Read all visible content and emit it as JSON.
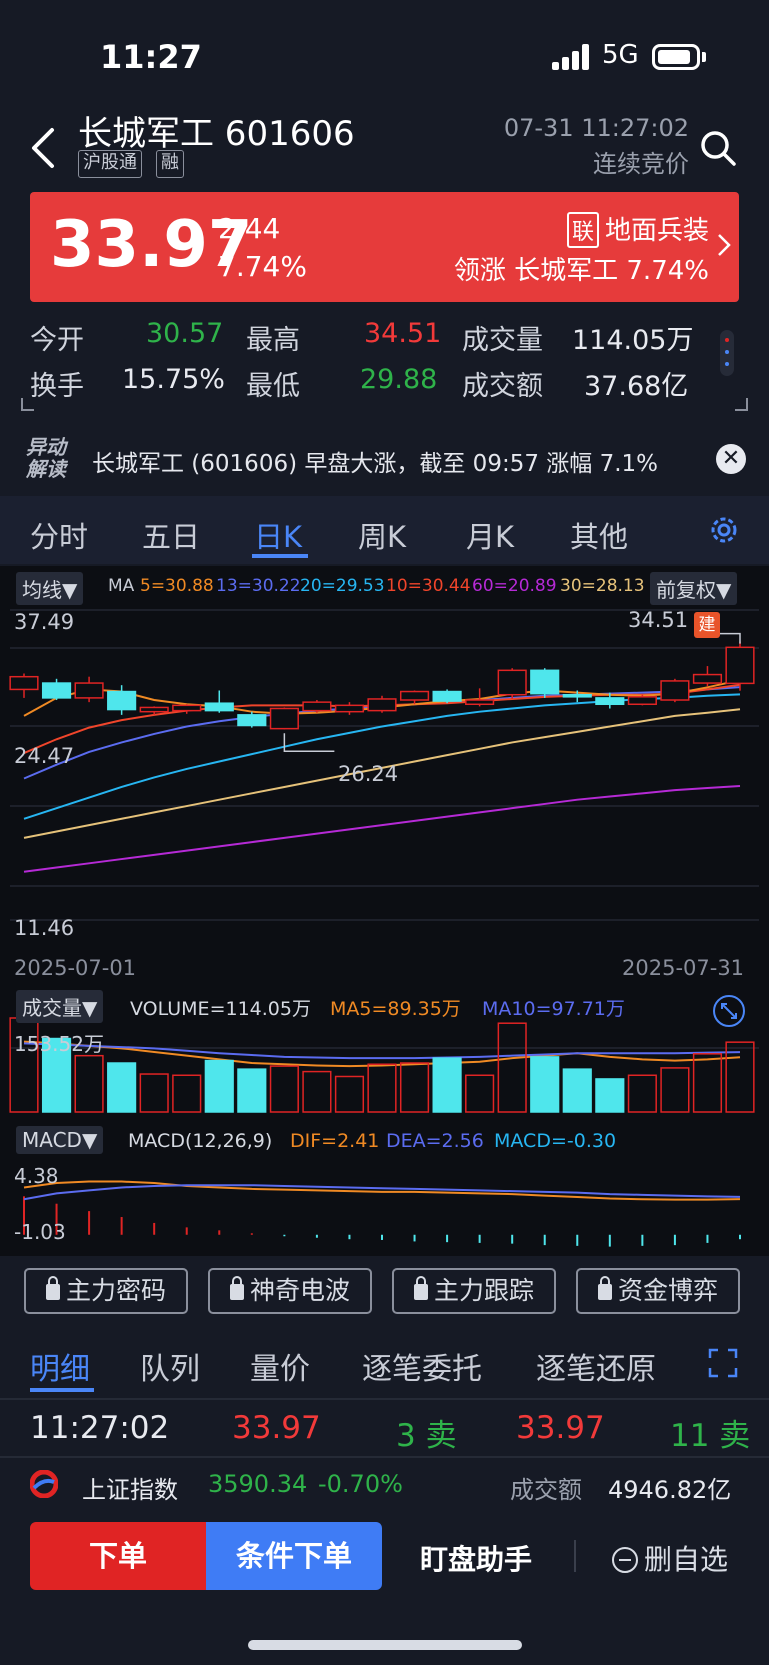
{
  "status": {
    "time": "11:27",
    "network": "5G"
  },
  "header": {
    "stock_name": "长城军工 601606",
    "tags": [
      "沪股通",
      "融"
    ],
    "datetime": "07-31 11:27:02",
    "session": "连续竞价"
  },
  "quote": {
    "price": "33.97",
    "change": "2.44",
    "change_pct": "7.74%",
    "sector_badge": "联",
    "sector": "地面兵装",
    "leader": "领涨 长城军工 7.74%"
  },
  "stats": {
    "open_label": "今开",
    "open": "30.57",
    "high_label": "最高",
    "high": "34.51",
    "vol_label": "成交量",
    "vol": "114.05万",
    "turnover_label": "换手",
    "turnover": "15.75%",
    "low_label": "最低",
    "low": "29.88",
    "amount_label": "成交额",
    "amount": "37.68亿"
  },
  "news": {
    "logo_line1": "异动",
    "logo_line2": "解读",
    "text": "长城军工 (601606) 早盘大涨，截至 09:57 涨幅 7.1%",
    "close": "✕"
  },
  "chart_tabs": [
    "分时",
    "五日",
    "日K",
    "周K",
    "月K",
    "其他"
  ],
  "chart": {
    "ma_dropdown": "均线▼",
    "ma_prefix": "MA",
    "ma5": "5=30.88",
    "ma13": "13=30.22",
    "ma20": "20=29.53",
    "ma10": "10=30.44",
    "ma60": "60=20.89",
    "ma30": "30=28.13",
    "adjust_dropdown": "前复权▼",
    "y_top": "37.49",
    "y_mid": "24.47",
    "y_bot": "11.46",
    "high_label": "34.51",
    "low_label": "26.24",
    "build_badge": "建",
    "date_start": "2025-07-01",
    "date_end": "2025-07-31",
    "vol_dropdown": "成交量▼",
    "vol_text": "VOLUME=114.05万",
    "vol_ma5": "MA5=89.35万",
    "vol_ma10": "MA10=97.71万",
    "vol_max": "153.52万",
    "macd_dropdown": "MACD▼",
    "macd_text": "MACD(12,26,9)",
    "dif": "DIF=2.41",
    "dea": "DEA=2.56",
    "macd_val": "MACD=-0.30",
    "macd_top": "4.38",
    "macd_bot": "-1.03",
    "colors": {
      "ma5": "#f08a24",
      "ma13": "#5b6cf0",
      "ma20": "#27b6f2",
      "ma10": "#f0452b",
      "ma60": "#b62ad6",
      "ma30": "#e6c27a",
      "up": "#e02424",
      "down": "#4fe6ec"
    }
  },
  "chart_data": {
    "type": "candlestick",
    "date_start": "2025-07-01",
    "date_end": "2025-07-31",
    "ylim": [
      11.46,
      37.49
    ],
    "candles": [
      {
        "o": 30.0,
        "h": 31.5,
        "l": 29.2,
        "c": 31.2
      },
      {
        "o": 30.6,
        "h": 31.0,
        "l": 29.0,
        "c": 29.2
      },
      {
        "o": 29.2,
        "h": 31.2,
        "l": 28.8,
        "c": 30.6
      },
      {
        "o": 29.8,
        "h": 30.4,
        "l": 27.6,
        "c": 28.1
      },
      {
        "o": 27.9,
        "h": 28.4,
        "l": 27.6,
        "c": 28.3
      },
      {
        "o": 28.0,
        "h": 28.6,
        "l": 27.7,
        "c": 28.5
      },
      {
        "o": 28.7,
        "h": 29.9,
        "l": 27.8,
        "c": 28.0
      },
      {
        "o": 27.6,
        "h": 27.9,
        "l": 26.4,
        "c": 26.6
      },
      {
        "o": 26.3,
        "h": 28.3,
        "l": 26.24,
        "c": 28.2
      },
      {
        "o": 28.0,
        "h": 29.0,
        "l": 27.8,
        "c": 28.8
      },
      {
        "o": 27.9,
        "h": 28.8,
        "l": 27.6,
        "c": 28.5
      },
      {
        "o": 28.0,
        "h": 29.4,
        "l": 27.8,
        "c": 29.1
      },
      {
        "o": 29.0,
        "h": 29.9,
        "l": 28.6,
        "c": 29.8
      },
      {
        "o": 29.8,
        "h": 30.0,
        "l": 28.7,
        "c": 28.9
      },
      {
        "o": 28.6,
        "h": 30.1,
        "l": 28.4,
        "c": 29.0
      },
      {
        "o": 29.5,
        "h": 32.0,
        "l": 29.1,
        "c": 31.8
      },
      {
        "o": 31.8,
        "h": 32.0,
        "l": 29.2,
        "c": 29.6
      },
      {
        "o": 29.5,
        "h": 29.9,
        "l": 28.8,
        "c": 29.3
      },
      {
        "o": 29.2,
        "h": 29.7,
        "l": 28.2,
        "c": 28.6
      },
      {
        "o": 28.6,
        "h": 29.5,
        "l": 28.5,
        "c": 29.3
      },
      {
        "o": 29.0,
        "h": 31.0,
        "l": 28.8,
        "c": 30.8
      },
      {
        "o": 30.6,
        "h": 32.2,
        "l": 30.3,
        "c": 31.4
      },
      {
        "o": 30.57,
        "h": 34.51,
        "l": 29.88,
        "c": 33.97
      }
    ],
    "ma5": [
      27.5,
      29.2,
      30.0,
      29.8,
      29.0,
      28.6,
      28.4,
      27.9,
      27.7,
      27.8,
      28.0,
      28.3,
      28.6,
      28.9,
      29.1,
      29.6,
      29.9,
      29.7,
      29.5,
      29.4,
      29.6,
      30.2,
      30.88
    ],
    "ma10": [
      24.0,
      25.3,
      26.4,
      27.1,
      27.6,
      28.0,
      28.3,
      28.5,
      28.5,
      28.5,
      28.4,
      28.5,
      28.6,
      28.7,
      28.9,
      29.1,
      29.3,
      29.4,
      29.5,
      29.5,
      29.6,
      30.0,
      30.44
    ],
    "ma13": [
      21.6,
      22.9,
      24.1,
      25.0,
      25.8,
      26.5,
      27.0,
      27.4,
      27.7,
      28.0,
      28.2,
      28.4,
      28.6,
      28.8,
      29.0,
      29.2,
      29.4,
      29.5,
      29.6,
      29.7,
      29.8,
      30.0,
      30.22
    ],
    "ma20": [
      17.8,
      18.8,
      19.8,
      20.8,
      21.7,
      22.5,
      23.2,
      23.9,
      24.6,
      25.3,
      25.9,
      26.5,
      27.0,
      27.5,
      27.9,
      28.2,
      28.5,
      28.7,
      28.9,
      29.1,
      29.2,
      29.4,
      29.53
    ],
    "ma30": [
      16.0,
      16.6,
      17.2,
      17.8,
      18.4,
      19.0,
      19.6,
      20.2,
      20.8,
      21.4,
      22.0,
      22.6,
      23.2,
      23.8,
      24.4,
      25.0,
      25.5,
      26.0,
      26.5,
      27.0,
      27.5,
      27.8,
      28.13
    ],
    "ma60": [
      12.8,
      13.2,
      13.6,
      14.0,
      14.4,
      14.8,
      15.2,
      15.6,
      16.0,
      16.4,
      16.8,
      17.2,
      17.6,
      18.0,
      18.4,
      18.8,
      19.2,
      19.6,
      19.9,
      20.2,
      20.5,
      20.7,
      20.89
    ],
    "volume": [
      153.52,
      120,
      92,
      80,
      62,
      60,
      84,
      70,
      75,
      66,
      58,
      78,
      80,
      88,
      60,
      145,
      90,
      70,
      54,
      60,
      72,
      95,
      114.05
    ],
    "volume_max": 153.52,
    "vol_ma5": [
      115,
      112,
      108,
      104,
      98,
      92,
      86,
      80,
      78,
      76,
      75,
      76,
      78,
      80,
      82,
      88,
      92,
      96,
      90,
      86,
      84,
      86,
      89.35
    ],
    "vol_ma10": [
      112,
      110,
      108,
      106,
      104,
      100,
      96,
      93,
      90,
      89,
      88,
      88,
      88,
      89,
      90,
      92,
      94,
      96,
      96,
      96,
      96,
      97,
      97.71
    ],
    "macd_hist": [
      2.6,
      2.1,
      1.6,
      1.2,
      0.8,
      0.5,
      0.3,
      0.1,
      -0.1,
      -0.2,
      -0.3,
      -0.35,
      -0.45,
      -0.5,
      -0.55,
      -0.6,
      -0.7,
      -0.75,
      -0.8,
      -0.75,
      -0.7,
      -0.55,
      -0.3
    ],
    "dif": [
      3.2,
      3.5,
      3.6,
      3.6,
      3.5,
      3.3,
      3.2,
      3.1,
      3.05,
      3.0,
      2.95,
      2.9,
      2.9,
      2.85,
      2.8,
      2.75,
      2.65,
      2.55,
      2.45,
      2.4,
      2.38,
      2.38,
      2.41
    ],
    "dea": [
      2.4,
      2.8,
      3.0,
      3.2,
      3.3,
      3.35,
      3.35,
      3.35,
      3.3,
      3.25,
      3.2,
      3.15,
      3.1,
      3.05,
      3.0,
      2.95,
      2.9,
      2.85,
      2.75,
      2.7,
      2.65,
      2.6,
      2.56
    ],
    "macd_ylim": [
      -1.03,
      4.38
    ]
  },
  "features": [
    "主力密码",
    "神奇电波",
    "主力跟踪",
    "资金博弈"
  ],
  "subtabs": [
    "明细",
    "队列",
    "量价",
    "逐笔委托",
    "逐笔还原"
  ],
  "tick": {
    "time": "11:27:02",
    "price1": "33.97",
    "qty1": "3 卖",
    "price2": "33.97",
    "qty2": "11 卖"
  },
  "index": {
    "name": "上证指数",
    "value": "3590.34",
    "change": "-0.70%",
    "amount_label": "成交额",
    "amount": "4946.82亿"
  },
  "actions": {
    "order": "下单",
    "cond_order": "条件下单",
    "helper": "盯盘助手",
    "remove": "删自选"
  }
}
